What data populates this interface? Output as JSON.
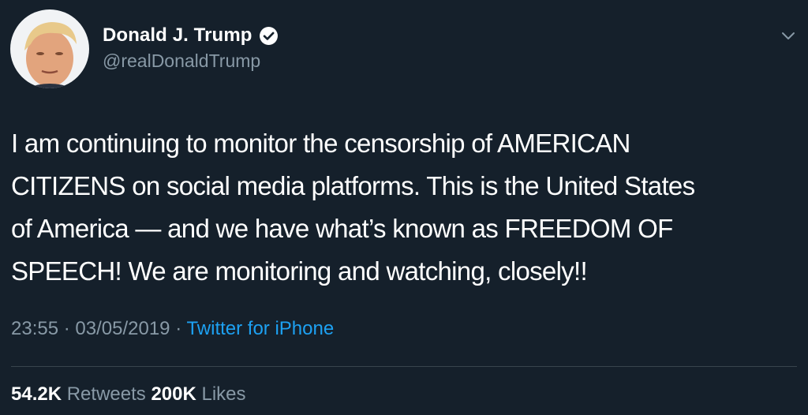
{
  "tweet": {
    "display_name": "Donald J. Trump",
    "handle": "@realDonaldTrump",
    "verified_icon": "verified-badge-icon",
    "text_lines": [
      "I am continuing to monitor the censorship of AMERICAN",
      "CITIZENS on social media platforms. This is the United States",
      "of America — and we have what’s known as FREEDOM OF",
      "SPEECH! We are monitoring and watching, closely!!"
    ],
    "time": "23:55",
    "date": "03/05/2019",
    "separator": "·",
    "source": "Twitter for iPhone"
  },
  "stats": {
    "retweets_count": "54.2K",
    "retweets_label": "Retweets",
    "likes_count": "200K",
    "likes_label": "Likes"
  },
  "colors": {
    "background": "#15202b",
    "text_primary": "#ffffff",
    "text_secondary": "#8899a6",
    "accent": "#1da1f2",
    "divider": "#38444d"
  }
}
